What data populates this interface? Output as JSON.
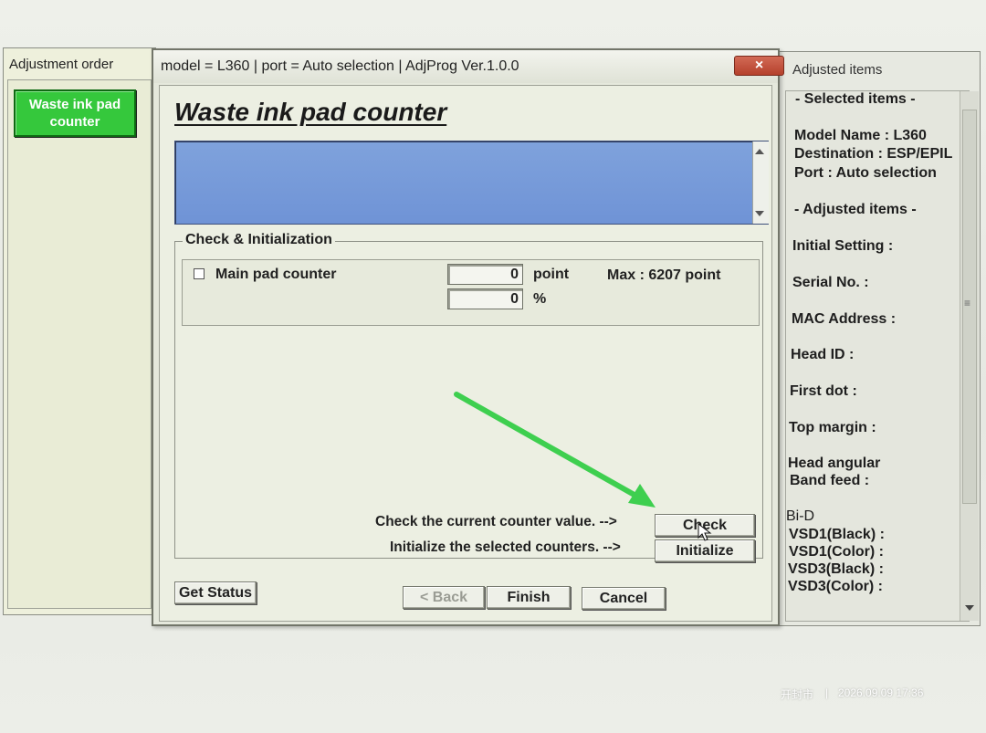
{
  "left_panel": {
    "title": "Adjustment order",
    "items": [
      {
        "label_line1": "Waste ink pad",
        "label_line2": "counter"
      }
    ]
  },
  "dialog": {
    "title": "model = L360 | port = Auto selection | AdjProg Ver.1.0.0",
    "close_label": "×",
    "heading": "Waste ink pad counter",
    "group": {
      "title": "Check & Initialization",
      "main_pad": {
        "label": "Main pad counter",
        "point_value": "0",
        "point_unit": "point",
        "percent_value": "0",
        "percent_unit": "%",
        "max_text": "Max : 6207 point"
      },
      "check_prompt": "Check the current counter value. -->",
      "check_label": "Check",
      "init_prompt": "Initialize the selected counters. -->",
      "init_label": "Initialize"
    },
    "buttons": {
      "get_status": "Get Status",
      "back": "< Back",
      "finish": "Finish",
      "cancel": "Cancel"
    }
  },
  "right_panel": {
    "title": "Adjusted items",
    "lines": {
      "selected_items": "- Selected items -",
      "model_name": "Model Name : L360",
      "destination": "Destination : ESP/EPIL",
      "port": "Port : Auto selection",
      "adjusted_items": "- Adjusted items -",
      "initial_setting": "Initial Setting :",
      "serial_no": "Serial No. :",
      "mac_address": "MAC Address :",
      "head_id": "Head ID :",
      "first_dot": "First dot :",
      "top_margin": "Top margin :",
      "head_angular": "Head angular",
      "band_feed": "Band feed :",
      "bi_d": "Bi-D",
      "vsd1_black": "VSD1(Black) :",
      "vsd1_color": "VSD1(Color) :",
      "vsd3_black": "VSD3(Black) :",
      "vsd3_color": "VSD3(Color) :"
    }
  },
  "watermark": {
    "location": "开封市",
    "separator": "|",
    "timestamp": "2026.09.09 17:36"
  },
  "colors": {
    "green_button": "#35c83c",
    "blue_area": "#7a9dda",
    "annotation_arrow": "#3ecf4f"
  }
}
